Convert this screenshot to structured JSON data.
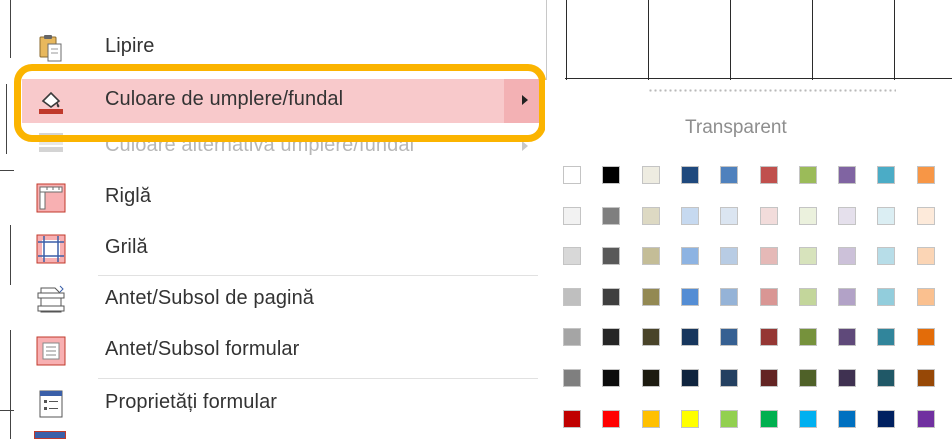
{
  "menu": {
    "items": [
      {
        "label": "Lipire",
        "icon": "paste-icon",
        "disabled": false
      },
      {
        "label": "Culoare de umplere/fundal",
        "icon": "fill-color-icon",
        "highlighted": true,
        "submenu": true
      },
      {
        "label": "Culoare alternativă umplere/fundal",
        "icon": "alternate-fill-icon",
        "disabled": true,
        "submenu": true
      },
      {
        "label": "Riglă",
        "icon": "ruler-icon"
      },
      {
        "label": "Grilă",
        "icon": "grid-icon"
      },
      {
        "label": "Antet/Subsol de pagină",
        "icon": "page-header-footer-icon"
      },
      {
        "label": "Antet/Subsol formular",
        "icon": "form-header-footer-icon"
      },
      {
        "label": "Proprietăți formular",
        "icon": "form-properties-icon"
      }
    ]
  },
  "palette": {
    "transparent_label": "Transparent",
    "rows": [
      [
        "#ffffff",
        "#000000",
        "#eeece1",
        "#1f497d",
        "#4f81bd",
        "#c0504d",
        "#9bbb59",
        "#8064a2",
        "#4bacc6",
        "#f79646"
      ],
      [
        "#f2f2f2",
        "#7f7f7f",
        "#ddd9c3",
        "#c6d9f0",
        "#dbe5f1",
        "#f2dcdb",
        "#ebf1dd",
        "#e5e0ec",
        "#dbeef3",
        "#fdeada"
      ],
      [
        "#d8d8d8",
        "#595959",
        "#c4bd97",
        "#8db3e2",
        "#b8cce4",
        "#e5b9b7",
        "#d7e3bc",
        "#ccc1d9",
        "#b7dde8",
        "#fbd5b5"
      ],
      [
        "#bfbfbf",
        "#3f3f3f",
        "#938953",
        "#548dd4",
        "#95b3d7",
        "#d99694",
        "#c3d69b",
        "#b2a2c7",
        "#92cddc",
        "#fac08f"
      ],
      [
        "#a5a5a5",
        "#262626",
        "#494429",
        "#17365d",
        "#366092",
        "#953734",
        "#76923c",
        "#5f497a",
        "#31859b",
        "#e36c09"
      ],
      [
        "#7f7f7f",
        "#0c0c0c",
        "#1d1b10",
        "#0f243e",
        "#244061",
        "#632423",
        "#4f6128",
        "#3f3151",
        "#205867",
        "#974806"
      ],
      [
        "#c00000",
        "#ff0000",
        "#ffc000",
        "#ffff00",
        "#92d050",
        "#00b050",
        "#00b0f0",
        "#0070c0",
        "#002060",
        "#7030a0"
      ]
    ]
  }
}
